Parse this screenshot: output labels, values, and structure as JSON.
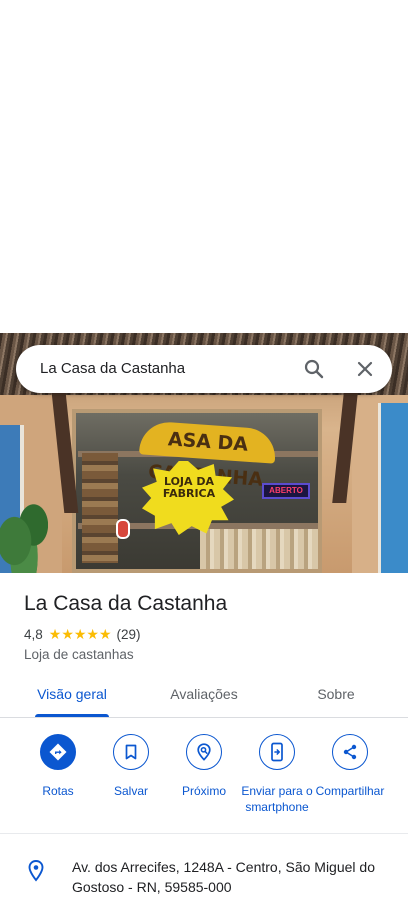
{
  "search": {
    "query": "La Casa da Castanha"
  },
  "photo": {
    "sign_arc_text": "ASA DA CASTANHA",
    "burst_text_line1": "LOJA DA",
    "burst_text_line2": "FABRICA",
    "neon_text": "ABERTO"
  },
  "place": {
    "title": "La Casa da Castanha",
    "rating": "4,8",
    "stars": "★★★★★",
    "review_count": "(29)",
    "category": "Loja de castanhas"
  },
  "tabs": [
    {
      "label": "Visão geral",
      "active": true
    },
    {
      "label": "Avaliações",
      "active": false
    },
    {
      "label": "Sobre",
      "active": false
    }
  ],
  "actions": [
    {
      "label": "Rotas",
      "icon": "directions-icon"
    },
    {
      "label": "Salvar",
      "icon": "bookmark-icon"
    },
    {
      "label": "Próximo",
      "icon": "nearby-icon"
    },
    {
      "label": "Enviar para o smartphone",
      "icon": "send-to-phone-icon"
    },
    {
      "label": "Compartilhar",
      "icon": "share-icon"
    }
  ],
  "address": {
    "text": "Av. dos Arrecifes, 1248A - Centro, São Miguel do Gostoso - RN, 59585-000"
  },
  "colors": {
    "accent": "#0b57d0",
    "star": "#fbbc04",
    "text_primary": "#202124",
    "text_secondary": "#5f6368"
  }
}
